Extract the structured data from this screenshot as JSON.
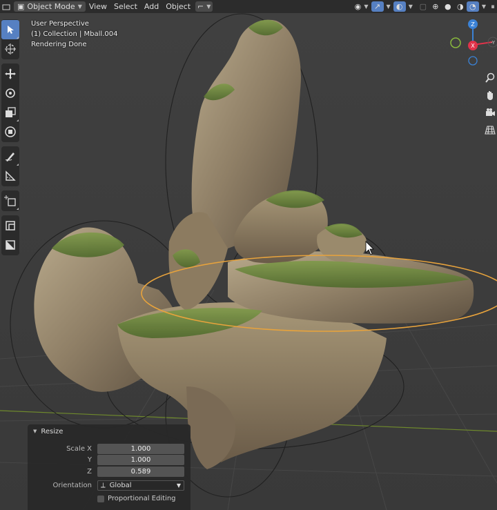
{
  "header": {
    "mode_label": "Object Mode",
    "menus": [
      "View",
      "Select",
      "Add",
      "Object"
    ]
  },
  "overlay": {
    "perspective": "User Perspective",
    "collection": "(1) Collection | Mball.004",
    "status": "Rendering Done"
  },
  "gizmo": {
    "z_label": "Z",
    "x_label": "X",
    "y_label": "-Y",
    "colors": {
      "x": "#e0334a",
      "y": "#89b93d",
      "z": "#3b82d6"
    }
  },
  "toolbar": {
    "tools": [
      "select-box-icon",
      "cursor-icon",
      "move-icon",
      "rotate-icon",
      "scale-icon",
      "transform-icon",
      "annotate-icon",
      "measure-icon",
      "add-cube-icon",
      "extrude-icon",
      "inset-icon"
    ]
  },
  "resize_panel": {
    "title": "Resize",
    "scale_x_label": "Scale X",
    "scale_x": "1.000",
    "y_label": "Y",
    "scale_y": "1.000",
    "z_label": "Z",
    "scale_z": "0.589",
    "orientation_label": "Orientation",
    "orientation_value": "Global",
    "proportional_label": "Proportional Editing"
  },
  "colors": {
    "active_tool": "#5680c2",
    "selection_outline": "#e8a33c"
  }
}
